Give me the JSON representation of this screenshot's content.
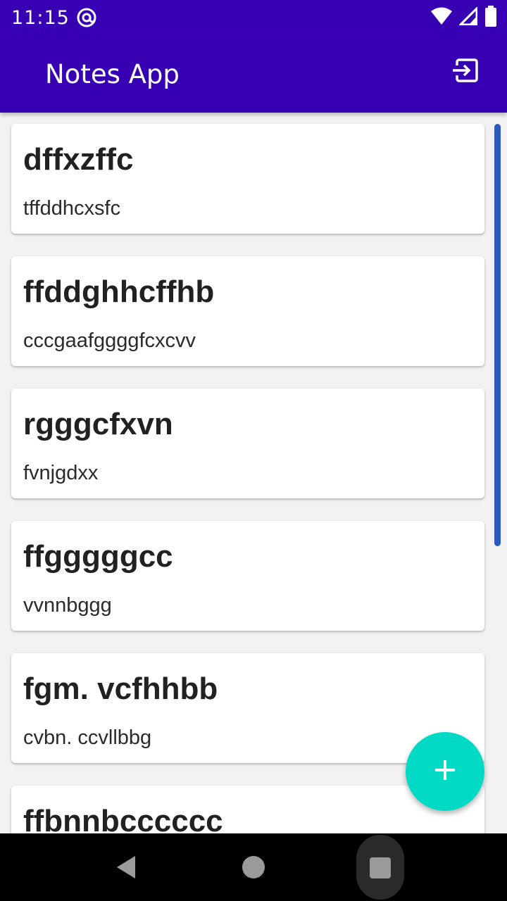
{
  "status_bar": {
    "time": "11:15",
    "icons": [
      "at-sign-icon",
      "wifi-icon",
      "signal-icon",
      "battery-icon"
    ]
  },
  "app_bar": {
    "title": "Notes App",
    "action_icon": "logout-icon"
  },
  "notes": [
    {
      "title": "dffxzffc",
      "body": "tffddhcxsfc"
    },
    {
      "title": "ffddghhcffhb",
      "body": "cccgaafggggfcxcvv"
    },
    {
      "title": "rgggcfxvn",
      "body": "fvnjgdxx"
    },
    {
      "title": "ffgggggcc",
      "body": "vvnnbggg"
    },
    {
      "title": "fgm. vcfhhbb",
      "body": "cvbn. ccvllbbg"
    },
    {
      "title": "ffbnnbcccccc",
      "body": ""
    }
  ],
  "fab": {
    "icon": "plus-icon"
  },
  "nav_bar": {
    "icons": [
      "back-icon",
      "home-icon",
      "recents-icon"
    ]
  },
  "colors": {
    "primary": "#3700b3",
    "accent": "#03dac5",
    "scrollbar": "#2d5bbd",
    "background": "#f2f2f2"
  }
}
